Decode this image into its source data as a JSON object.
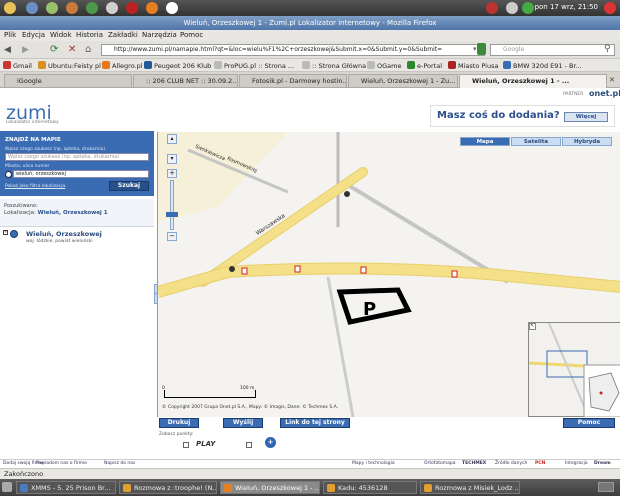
{
  "system": {
    "clock": "pon 17 wrz, 21:50"
  },
  "window": {
    "title": "Wieluń, Orzeszkowej 1 - Zumi.pl Lokalizator internetowy - Mozilla Firefox"
  },
  "menu": [
    "Plik",
    "Edycja",
    "Widok",
    "Historia",
    "Zakładki",
    "Narzędzia",
    "Pomoc"
  ],
  "nav": {
    "url": "http://www.zumi.pl/namapie.html?qt=&loc=wielu%F1%2C+orzeszkowej&Submit.x=0&Submit.y=0&Submit=",
    "search_placeholder": "Google"
  },
  "bookmarks": [
    "Gmail",
    "Ubuntu:Feisty pl",
    "Allegro.pl",
    "Peugeot 206 Klub",
    "ProPUG.pl :: Strona ...",
    ":: Strona Główna",
    "OGame",
    "e-Portal",
    "Miasto Piusa",
    "BMW 320d E91 - Br..."
  ],
  "tabs": [
    "iGoogle",
    ":: 206 CLUB NET :: 30.09.2...",
    "Fotosik.pl - Darmowy hostin...",
    "Wieluń, Orzeszkowej 1 - Zu...",
    "Wieluń, Orzeszkowej 1 - ..."
  ],
  "header": {
    "logo": "zumi",
    "logo_sub": "Lokalizator internetowy",
    "partner_label": "PARTNER",
    "partner_name": "onet.pl",
    "ad_text": "Masz coś do dodania?",
    "ad_button": "Więcej"
  },
  "find": {
    "title": "ZNAJDŹ NA MAPIE",
    "what_label": "Wpisz czego szukasz (np. apteka, drukarnia)",
    "what_placeholder": "Wpisz czego szukasz (np. apteka, drukarnia)",
    "where_label": "Miasto, ulica numer",
    "where_value": "wieluń, orzeszkowej",
    "show_link": "Pokaż jako filtra lokalizacja",
    "search_button": "Szukaj"
  },
  "sought": {
    "label": "Poszukiwano:",
    "location_label": "Lokalizacja:",
    "location_value": "Wieluń, Orzeszkowej 1"
  },
  "result": {
    "name": "Wieluń, Orzeszkowej",
    "sub": "woj. łódzkie, powiat wieluński"
  },
  "map": {
    "tabs": [
      "Mapa",
      "Satelita",
      "Hybryda"
    ],
    "active_tab": "Mapa",
    "streets": [
      "Sienkiewicza",
      "Kosmowskiej",
      "Warszawska"
    ],
    "scale_start": "0",
    "scale_end": "100 m",
    "copyright": "© Copyright 2007 Grupa Onet.pl S.A., Mapy: © Imagis, Dane: © Techmex S.A."
  },
  "actions": {
    "print": "Drukuj",
    "send": "Wyślij",
    "link": "Link do tej strony",
    "help": "Pomoc",
    "see_points": "Zobacz punkty:",
    "play": "PLAY"
  },
  "footer": {
    "left": [
      "Dodaj swoją firmę",
      "Powiadom nas o firmie",
      "Napisz do nas"
    ],
    "right": [
      "Mapy i technologia",
      "Ortofotomapa",
      "TECHMEX",
      "Źródło danych",
      "PCN",
      "Integracja",
      "Dream"
    ]
  },
  "status": "Zakończono",
  "taskbar": [
    "XMMS - 5. 25 Prison Br...",
    "Rozmowa z :troophe! (N...",
    "Wieluń, Orzeszkowej 1 - ...",
    "Kadu: 4536128",
    "Rozmowa z Misiek_Lodz ..."
  ],
  "colors": {
    "accent": "#3a6cb4",
    "road": "#f5e08a",
    "map_bg": "#f4f3ef"
  }
}
